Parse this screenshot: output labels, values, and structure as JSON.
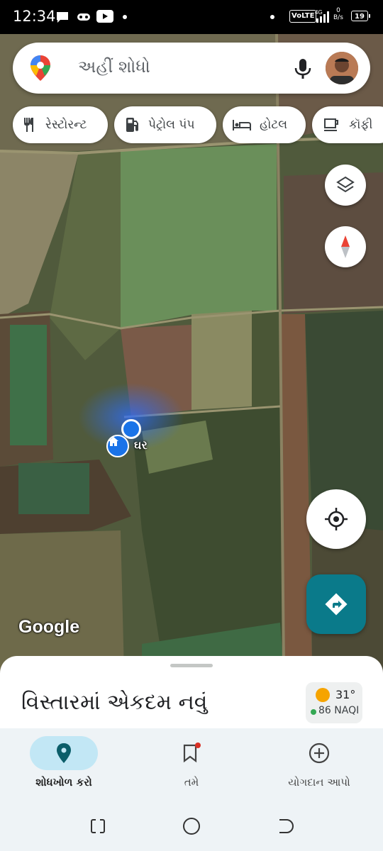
{
  "status_bar": {
    "time": "12:34",
    "network_label": "VoLTE",
    "signal_label": "4G",
    "speed_value": "0",
    "speed_unit": "B/s",
    "battery": "19"
  },
  "search": {
    "placeholder": "અહીં શોધો"
  },
  "chips": [
    {
      "label": "રેસ્ટોરન્ટ",
      "icon": "restaurant-icon"
    },
    {
      "label": "પેટ્રોલ પંપ",
      "icon": "gas-station-icon"
    },
    {
      "label": "હોટલ",
      "icon": "hotel-icon"
    },
    {
      "label": "કૉફી",
      "icon": "coffee-icon"
    }
  ],
  "map": {
    "home_label": "ઘર",
    "attribution": "Google"
  },
  "sheet": {
    "title": "વિસ્તારમાં એકદમ નવું",
    "weather_temp": "31°",
    "weather_aqi": "86 NAQI"
  },
  "bottom_nav": {
    "items": [
      {
        "label": "શોધખોળ કરો",
        "icon": "explore-pin-icon",
        "active": true
      },
      {
        "label": "તમે",
        "icon": "saved-bookmark-icon",
        "active": false
      },
      {
        "label": "યોગદાન આપો",
        "icon": "contribute-plus-icon",
        "active": false
      }
    ]
  },
  "colors": {
    "accent": "#0a7a8a",
    "active_pill": "#c2e7f5",
    "location_blue": "#1a73e8"
  }
}
